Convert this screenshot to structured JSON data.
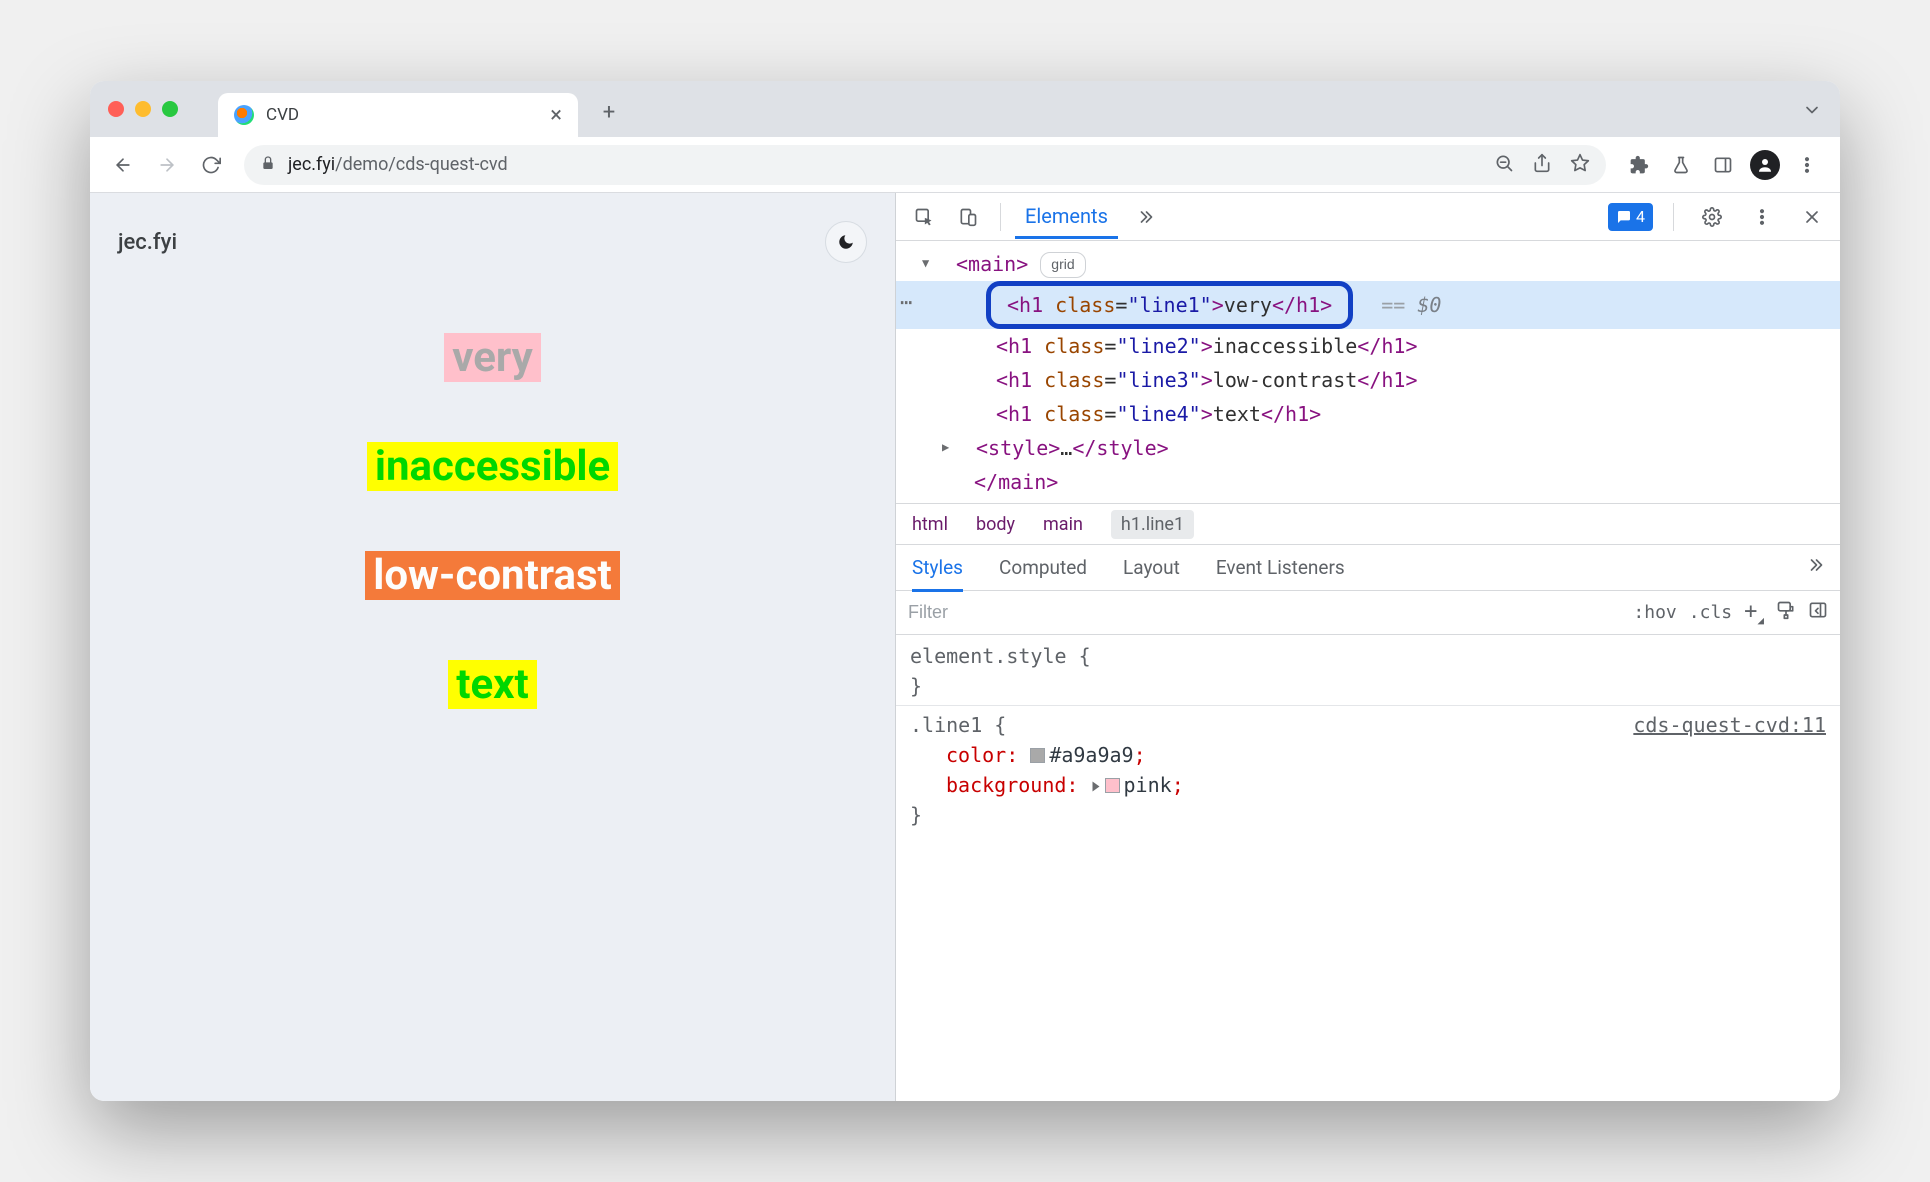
{
  "tab": {
    "title": "CVD"
  },
  "omnibox": {
    "domain": "jec.fyi",
    "path": "/demo/cds-quest-cvd"
  },
  "page": {
    "site_title": "jec.fyi",
    "line1": "very",
    "line2": "inaccessible",
    "line3": "low-contrast",
    "line4": "text"
  },
  "devtools": {
    "tabs": {
      "elements": "Elements"
    },
    "issues_count": "4",
    "dom": {
      "main_tag": "main",
      "main_badge": "grid",
      "h1_1": {
        "open": "<h1 class=\"line1\">",
        "text": "very",
        "close": "</h1>",
        "suffix": "== $0"
      },
      "h1_2": {
        "open": "<h1 class=\"line2\">",
        "text": "inaccessible",
        "close": "</h1>"
      },
      "h1_3": {
        "open": "<h1 class=\"line3\">",
        "text": "low-contrast",
        "close": "</h1>"
      },
      "h1_4": {
        "open": "<h1 class=\"line4\">",
        "text": "text",
        "close": "</h1>"
      },
      "style_row": "<style>…</style>",
      "main_close": "</main>"
    },
    "crumb": {
      "c1": "html",
      "c2": "body",
      "c3": "main",
      "c4": "h1.line1"
    },
    "subtabs": {
      "styles": "Styles",
      "computed": "Computed",
      "layout": "Layout",
      "listeners": "Event Listeners"
    },
    "filter": {
      "placeholder": "Filter",
      "hov": ":hov",
      "cls": ".cls"
    },
    "styles": {
      "element_style": "element.style {",
      "close1": "}",
      "rule_sel": ".line1 {",
      "source": "cds-quest-cvd:11",
      "p1_name": "color",
      "p1_val": "#a9a9a9",
      "p2_name": "background",
      "p2_val": "pink",
      "close2": "}"
    }
  }
}
